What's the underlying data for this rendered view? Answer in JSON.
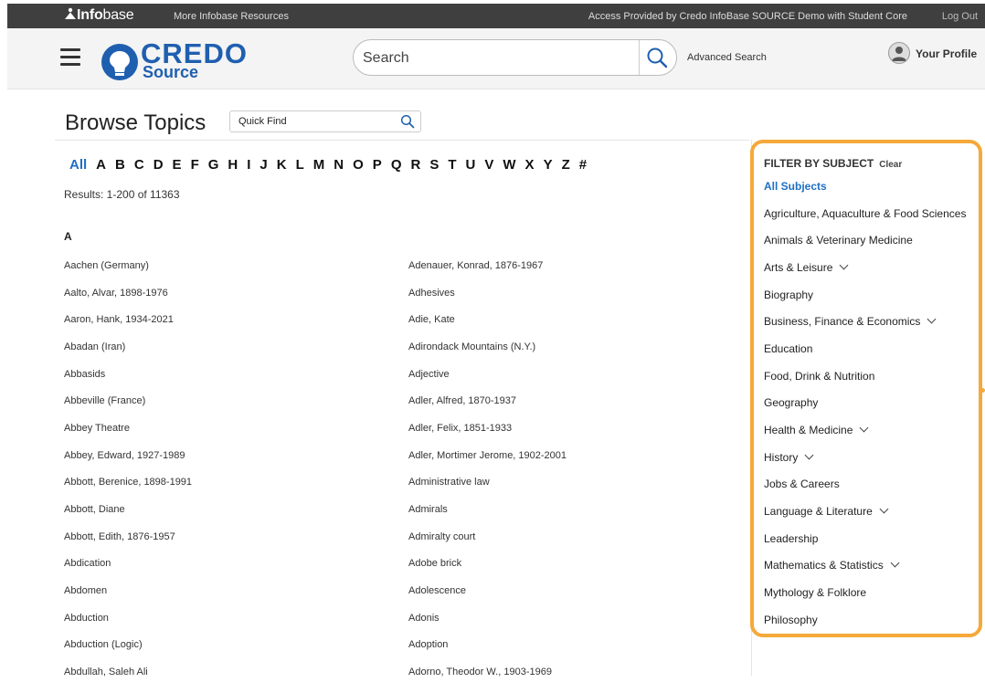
{
  "topbar": {
    "logo_bold": "Info",
    "logo_light": "base",
    "more_resources": "More Infobase Resources",
    "access": "Access Provided by Credo InfoBase SOURCE Demo with Student Core",
    "logout": "Log Out"
  },
  "header": {
    "brand_name": "CREDO",
    "brand_sub": "Source",
    "search_placeholder": "Search",
    "advanced_search": "Advanced Search",
    "profile": "Your Profile"
  },
  "browse": {
    "title": "Browse Topics",
    "quick_find_placeholder": "Quick Find",
    "letters": [
      "All",
      "A",
      "B",
      "C",
      "D",
      "E",
      "F",
      "G",
      "H",
      "I",
      "J",
      "K",
      "L",
      "M",
      "N",
      "O",
      "P",
      "Q",
      "R",
      "S",
      "T",
      "U",
      "V",
      "W",
      "X",
      "Y",
      "Z",
      "#"
    ],
    "active_letter": "All",
    "results": "Results: 1-200 of 11363",
    "section": "A"
  },
  "topics_left": [
    "Aachen (Germany)",
    "Aalto, Alvar, 1898-1976",
    "Aaron, Hank, 1934-2021",
    "Abadan (Iran)",
    "Abbasids",
    "Abbeville (France)",
    "Abbey Theatre",
    "Abbey, Edward, 1927-1989",
    "Abbott, Berenice, 1898-1991",
    "Abbott, Diane",
    "Abbott, Edith, 1876-1957",
    "Abdication",
    "Abdomen",
    "Abduction",
    "Abduction (Logic)",
    "Abdullah, Saleh Ali"
  ],
  "topics_right": [
    "Adenauer, Konrad, 1876-1967",
    "Adhesives",
    "Adie, Kate",
    "Adirondack Mountains (N.Y.)",
    "Adjective",
    "Adler, Alfred, 1870-1937",
    "Adler, Felix, 1851-1933",
    "Adler, Mortimer Jerome, 1902-2001",
    "Administrative law",
    "Admirals",
    "Admiralty court",
    "Adobe brick",
    "Adolescence",
    "Adonis",
    "Adoption",
    "Adorno, Theodor W., 1903-1969"
  ],
  "filter": {
    "heading": "FILTER BY SUBJECT",
    "clear": "Clear",
    "subjects": [
      {
        "label": "All Subjects",
        "selected": true,
        "expandable": false
      },
      {
        "label": "Agriculture, Aquaculture & Food Sciences",
        "selected": false,
        "expandable": false
      },
      {
        "label": "Animals & Veterinary Medicine",
        "selected": false,
        "expandable": false
      },
      {
        "label": "Arts & Leisure",
        "selected": false,
        "expandable": true
      },
      {
        "label": "Biography",
        "selected": false,
        "expandable": false
      },
      {
        "label": "Business, Finance & Economics",
        "selected": false,
        "expandable": true
      },
      {
        "label": "Education",
        "selected": false,
        "expandable": false
      },
      {
        "label": "Food, Drink & Nutrition",
        "selected": false,
        "expandable": false
      },
      {
        "label": "Geography",
        "selected": false,
        "expandable": false
      },
      {
        "label": "Health & Medicine",
        "selected": false,
        "expandable": true
      },
      {
        "label": "History",
        "selected": false,
        "expandable": true
      },
      {
        "label": "Jobs & Careers",
        "selected": false,
        "expandable": false
      },
      {
        "label": "Language & Literature",
        "selected": false,
        "expandable": true
      },
      {
        "label": "Leadership",
        "selected": false,
        "expandable": false
      },
      {
        "label": "Mathematics & Statistics",
        "selected": false,
        "expandable": true
      },
      {
        "label": "Mythology & Folklore",
        "selected": false,
        "expandable": false
      },
      {
        "label": "Philosophy",
        "selected": false,
        "expandable": false
      }
    ]
  },
  "colors": {
    "brand_blue": "#1f5fb0",
    "link_blue": "#1f6fc5",
    "highlight_orange": "#f5a93a",
    "topbar_bg": "#3f3f3f"
  }
}
